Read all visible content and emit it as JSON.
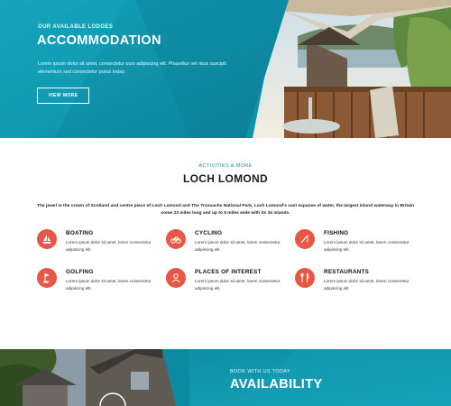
{
  "hero": {
    "eyebrow": "OUR AVAILABLE LODGES",
    "title": "ACCOMMODATION",
    "text": "Lorem ipsum dolor sit amet, consectetur ours adipiscing elit. Phasellus vel risus suscipit elementum sed consectetur purus today.",
    "button_label": "VIEW MORE"
  },
  "activities": {
    "eyebrow": "ACTIVITIES & MORE",
    "title": "LOCH LOMOND",
    "intro": "The jewel in the crown of Scotland and centre piece of Loch Lomond and The Trossachs National Park, Loch Lomond's vast expanse of water, the largest inland waterway in Britain some 23 miles long and up to 5 miles wide with its 34 islands.",
    "items": [
      {
        "title": "BOATING",
        "text": "Lorem ipsum dolor sit amet, lorem consectetur adipiscing elit.",
        "icon": "sailboat-icon"
      },
      {
        "title": "CYCLING",
        "text": "Lorem ipsum dolor sit amet, lorem consectetur adipiscing elit.",
        "icon": "bicycle-icon"
      },
      {
        "title": "FISHING",
        "text": "Lorem ipsum dolor sit amet, lorem consectetur adipiscing elit.",
        "icon": "fishing-icon"
      },
      {
        "title": "GOLFING",
        "text": "Lorem ipsum dolor sit amet, lorem consectetur adipiscing elit.",
        "icon": "golf-icon"
      },
      {
        "title": "PLACES OF INTEREST",
        "text": "Lorem ipsum dolor sit amet, lorem consectetur adipiscing elit.",
        "icon": "person-icon"
      },
      {
        "title": "RESTAURANTS",
        "text": "Lorem ipsum dolor sit amet, lorem consectetur adipiscing elit.",
        "icon": "cutlery-icon"
      }
    ]
  },
  "availability": {
    "eyebrow": "BOOK WITH US TODAY",
    "title": "AVAILABILITY"
  },
  "colors": {
    "teal": "#0f93aa",
    "teal_dark": "#0b7f95",
    "accent_red": "#e65745",
    "title_dark": "#1b1b1b"
  }
}
